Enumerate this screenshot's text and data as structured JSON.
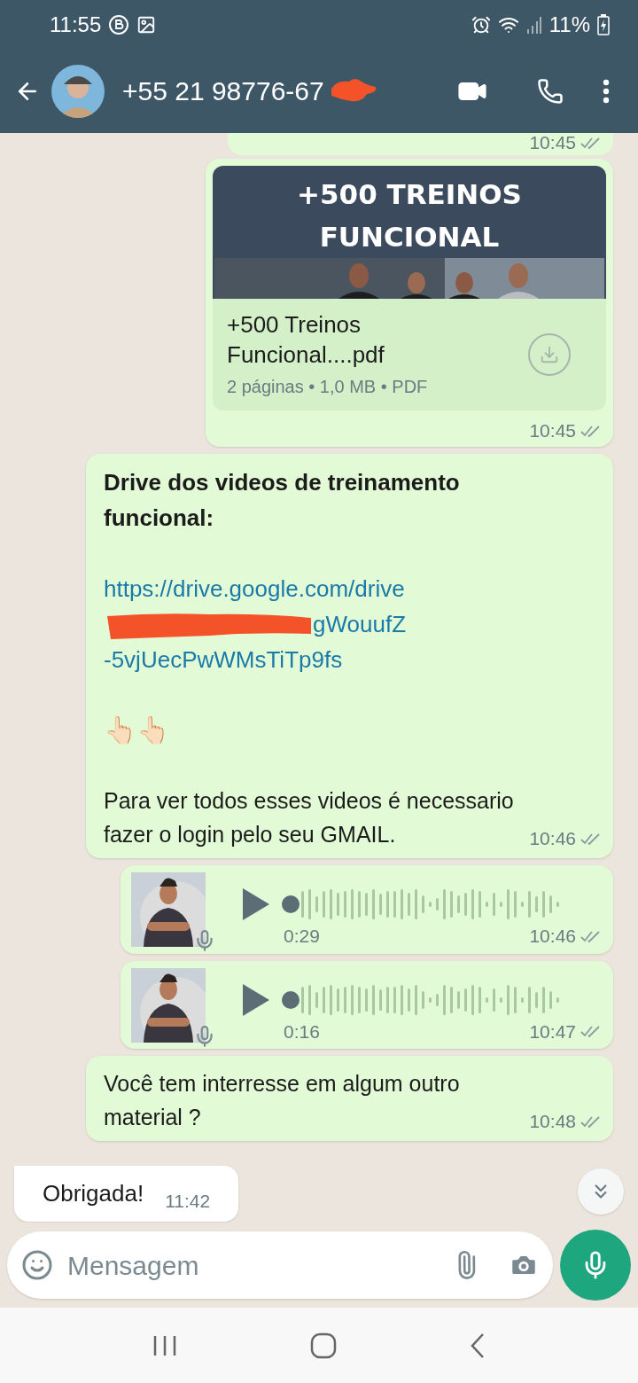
{
  "status_bar": {
    "time": "11:55",
    "battery": "11%"
  },
  "header": {
    "title": "+55 21 98776-67"
  },
  "messages": [
    {
      "kind": "time_only",
      "time": "10:45"
    },
    {
      "kind": "document",
      "preview_title": "+500 TREINOS FUNCIONAL",
      "file_name": "+500 Treinos Funcional....pdf",
      "details": "2 páginas • 1,0 MB • PDF",
      "time": "10:45"
    },
    {
      "kind": "text",
      "heading": "Drive dos videos de treinamento funcional:",
      "link_lines": [
        "https://drive.google.com/drive",
        "gWouufZ",
        "-5vjUecPwWMsTiTp9fs"
      ],
      "emoji": "👆🏻👆🏻",
      "body": "Para ver todos esses videos é necessario fazer o login pelo seu GMAIL.",
      "time": "10:46"
    },
    {
      "kind": "voice",
      "duration": "0:29",
      "level": 0,
      "time": "10:46"
    },
    {
      "kind": "voice",
      "duration": "0:16",
      "level": 0,
      "time": "10:47"
    },
    {
      "kind": "text",
      "body": "Você tem interresse em algum outro material ?",
      "time": "10:48"
    },
    {
      "kind": "incoming",
      "body": "Obrigada!",
      "time": "11:42"
    }
  ],
  "composer": {
    "placeholder": "Mensagem"
  }
}
